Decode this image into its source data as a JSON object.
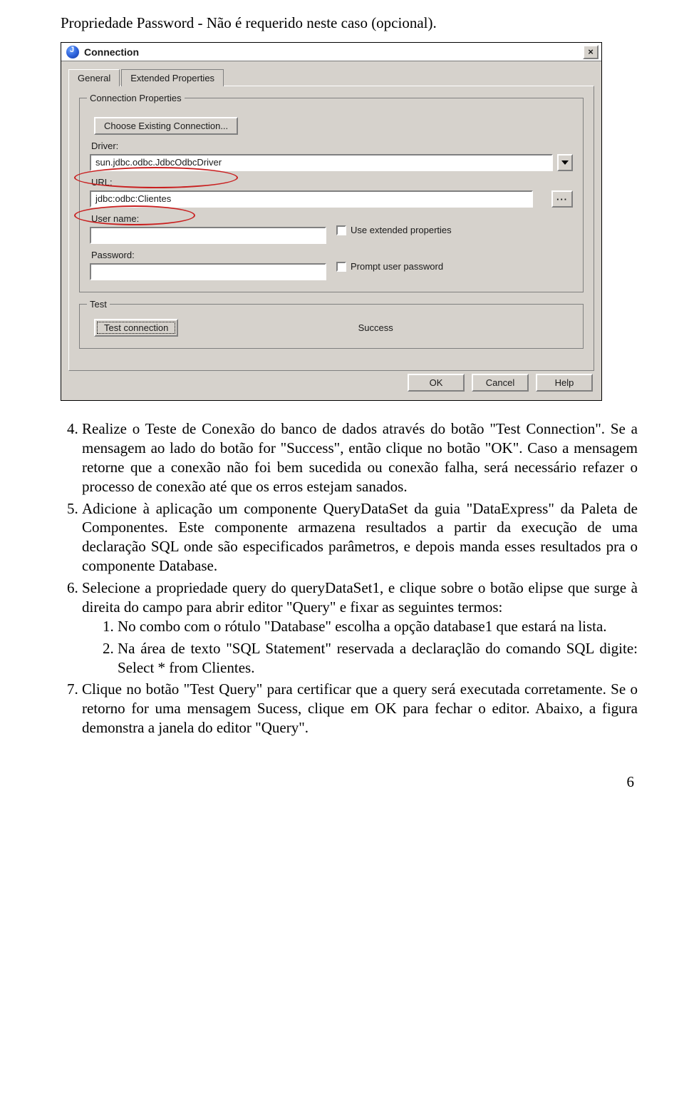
{
  "intro": "Propriedade Password - Não é requerido neste caso (opcional).",
  "dialog": {
    "title": "Connection",
    "tabs": {
      "general": "General",
      "extended": "Extended Properties"
    },
    "group_conn": "Connection Properties",
    "choose_btn": "Choose Existing Connection...",
    "driver_label": "Driver:",
    "driver_value": "sun.jdbc.odbc.JdbcOdbcDriver",
    "url_label": "URL:",
    "url_value": "jdbc:odbc:Clientes",
    "browse_label": "···",
    "user_label": "User name:",
    "user_value": "",
    "use_ext_label": "Use extended properties",
    "password_label": "Password:",
    "password_value": "",
    "prompt_label": "Prompt user password",
    "group_test": "Test",
    "test_btn": "Test connection",
    "test_status": "Success",
    "ok_btn": "OK",
    "cancel_btn": "Cancel",
    "help_btn": "Help"
  },
  "body": {
    "p4": "Realize o Teste de Conexão do banco de dados através do botão \"Test Connection\". Se a mensagem ao lado do botão for \"Success\", então clique no botão \"OK\". Caso a mensagem retorne que a conexão não foi bem sucedida ou conexão falha, será necessário refazer o processo de conexão até que os erros estejam sanados.",
    "p5": "Adicione à aplicação um componente QueryDataSet da guia \"DataExpress\" da Paleta de Componentes. Este componente armazena resultados a partir da execução de uma declaração SQL onde são especificados parâmetros, e depois manda esses resultados pra o componente Database.",
    "p6": "Selecione a propriedade query do queryDataSet1, e clique sobre o botão elipse que surge à direita do campo para abrir editor \"Query\" e fixar as seguintes termos:",
    "p6_1": "No combo com o rótulo \"Database\" escolha a opção database1 que estará na lista.",
    "p6_2": "Na área de texto \"SQL Statement\" reservada a declaraçlão do comando SQL digite: Select * from Clientes.",
    "p7": "Clique no botão \"Test Query\" para certificar que a query será executada corretamente. Se o retorno for uma mensagem Sucess, clique em OK para fechar o editor. Abaixo, a figura demonstra a janela do editor \"Query\"."
  },
  "page_number": "6"
}
